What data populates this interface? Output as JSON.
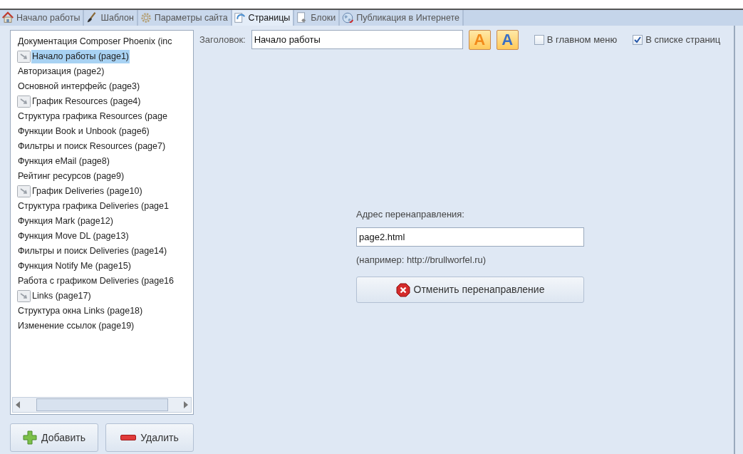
{
  "tabs": [
    {
      "label": "Начало работы",
      "selected": false
    },
    {
      "label": "Шаблон",
      "selected": false
    },
    {
      "label": "Параметры сайта",
      "selected": false
    },
    {
      "label": "Страницы",
      "selected": true
    },
    {
      "label": "Блоки",
      "selected": false
    },
    {
      "label": "Публикация в Интернете",
      "selected": false
    }
  ],
  "pages": [
    {
      "label": "Документация Composer Phoenix (inc",
      "redirect": false,
      "selected": false
    },
    {
      "label": "Начало работы (page1)",
      "redirect": true,
      "selected": true
    },
    {
      "label": "Авторизация (page2)",
      "redirect": false,
      "selected": false
    },
    {
      "label": "Основной интерфейс (page3)",
      "redirect": false,
      "selected": false
    },
    {
      "label": "График Resources (page4)",
      "redirect": true,
      "selected": false
    },
    {
      "label": "Структура графика Resources (page",
      "redirect": false,
      "selected": false
    },
    {
      "label": "Функции Book и Unbook (page6)",
      "redirect": false,
      "selected": false
    },
    {
      "label": "Фильтры и поиск Resources (page7)",
      "redirect": false,
      "selected": false
    },
    {
      "label": "Функция eMail (page8)",
      "redirect": false,
      "selected": false
    },
    {
      "label": "Рейтинг ресурсов (page9)",
      "redirect": false,
      "selected": false
    },
    {
      "label": "График Deliveries (page10)",
      "redirect": true,
      "selected": false
    },
    {
      "label": "Структура графика Deliveries (page1",
      "redirect": false,
      "selected": false
    },
    {
      "label": "Функция Mark (page12)",
      "redirect": false,
      "selected": false
    },
    {
      "label": "Функция Move DL (page13)",
      "redirect": false,
      "selected": false
    },
    {
      "label": "Фильтры и поиск Deliveries (page14)",
      "redirect": false,
      "selected": false
    },
    {
      "label": "Функция Notify Me (page15)",
      "redirect": false,
      "selected": false
    },
    {
      "label": "Работа с графиком Deliveries (page16",
      "redirect": false,
      "selected": false
    },
    {
      "label": "Links (page17)",
      "redirect": true,
      "selected": false
    },
    {
      "label": "Структура окна Links (page18)",
      "redirect": false,
      "selected": false
    },
    {
      "label": "Изменение ссылок (page19)",
      "redirect": false,
      "selected": false
    }
  ],
  "list_buttons": [
    {
      "label": "Добавить"
    },
    {
      "label": "Удалить"
    }
  ],
  "title_field": {
    "label": "Заголовок:",
    "value": "Начало работы"
  },
  "font_buttons": [
    {
      "glyph": "A"
    },
    {
      "glyph": "A"
    }
  ],
  "checkboxes": [
    {
      "label": "В главном меню",
      "checked": false
    },
    {
      "label": "В списке страниц",
      "checked": true
    }
  ],
  "redirect": {
    "label": "Адрес перенаправления:",
    "value": "page2.html",
    "hint": "(например: http://brullworfel.ru)",
    "button": "Отменить перенаправление"
  }
}
